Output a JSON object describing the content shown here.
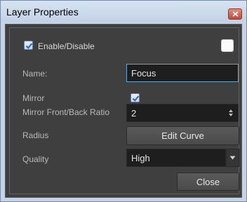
{
  "window": {
    "title": "Layer Properties"
  },
  "enable": {
    "label": "Enable/Disable",
    "checked": true
  },
  "swatch_color": "#fafafa",
  "name": {
    "label": "Name:",
    "value": "Focus"
  },
  "mirror": {
    "label": "Mirror",
    "checked": true
  },
  "ratio": {
    "label": "Mirror Front/Back Ratio",
    "value": "2"
  },
  "radius": {
    "label": "Radius",
    "button": "Edit Curve"
  },
  "quality": {
    "label": "Quality",
    "selected": "High"
  },
  "close_button": "Close",
  "colors": {
    "accent": "#5fa8d0",
    "panel": "#3f3f3f",
    "field": "#1e1e1e"
  }
}
